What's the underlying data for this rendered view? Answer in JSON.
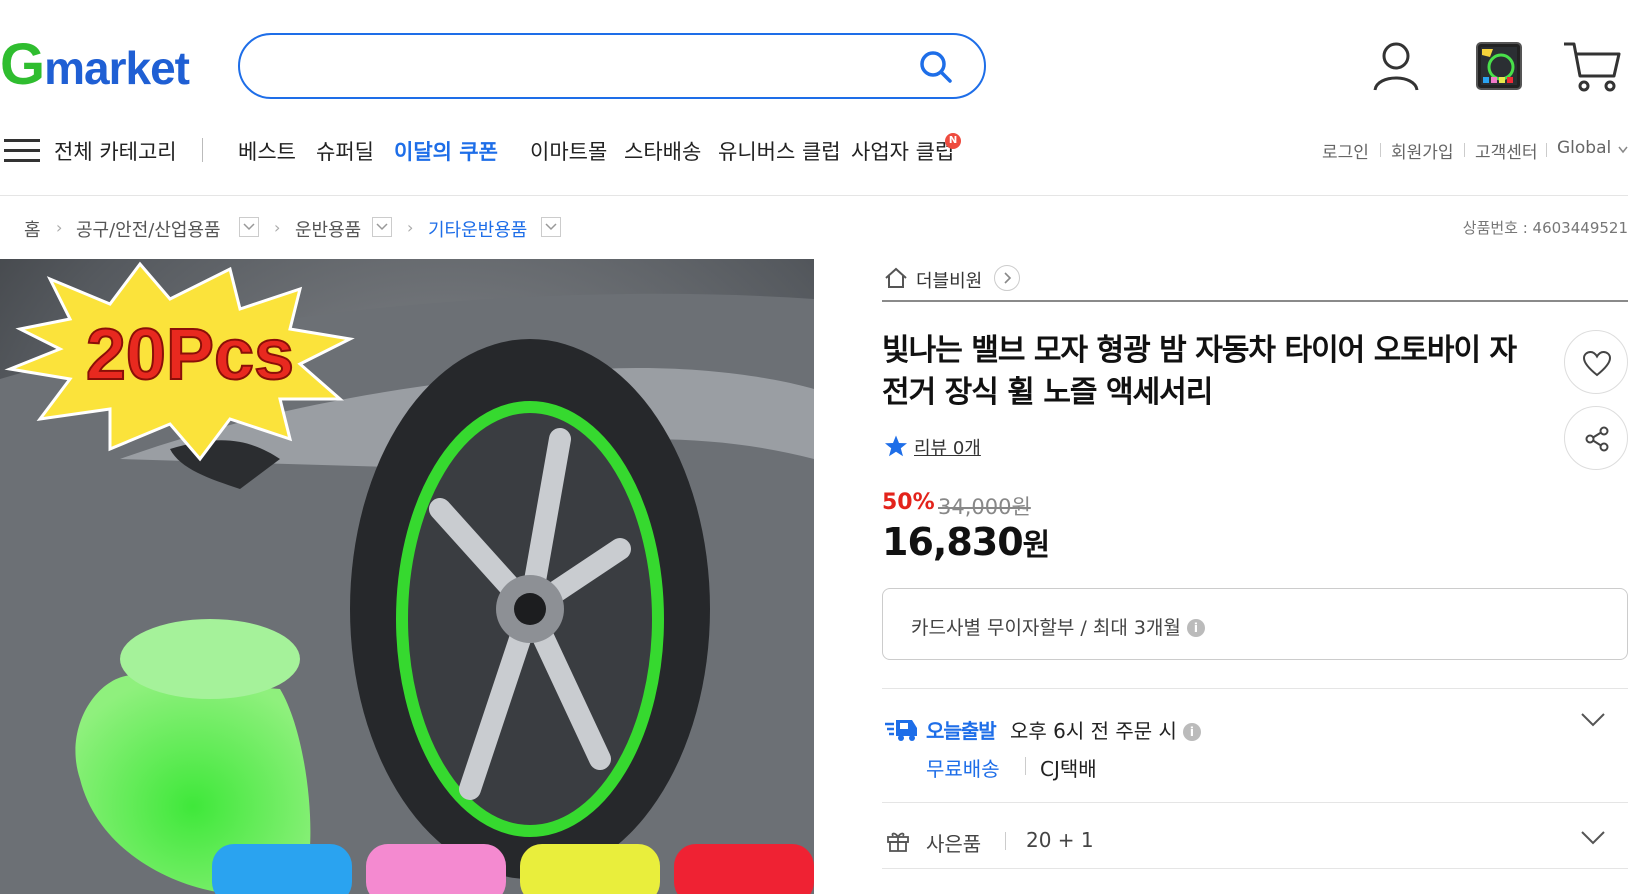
{
  "header": {
    "logo_g": "G",
    "logo_rest": "market",
    "search_placeholder": "",
    "icons": [
      "search-icon",
      "user-icon",
      "recent-item-thumbnail",
      "cart-icon"
    ]
  },
  "nav": {
    "category_label": "전체 카테고리",
    "items": [
      "베스트",
      "슈퍼딜",
      "이달의 쿠폰",
      "이마트몰",
      "스타배송",
      "유니버스 클럽",
      "사업자 클럽"
    ],
    "new_badge": "N",
    "utility": [
      "로그인",
      "회원가입",
      "고객센터",
      "Global"
    ]
  },
  "breadcrumb": {
    "items": [
      "홈",
      "공구/안전/산업용품",
      "운반용품",
      "기타운반용품"
    ],
    "product_number": "상품번호 : 4603449521"
  },
  "product_image": {
    "badge_text": "20Pcs"
  },
  "product": {
    "seller": "더블비원",
    "title": "빛나는 밸브 모자 형광 밤 자동차 타이어 오토바이 자전거 장식 휠 노즐 액세서리",
    "review_label": "리뷰 0개",
    "discount": "50%",
    "original_price": "34,000원",
    "price_number": "16,830",
    "price_unit": "원",
    "installment": "카드사별 무이자할부 / 최대 3개월",
    "info_glyph": "i",
    "shipping_badge": "오늘출발",
    "shipping_time": "오후 6시 전 주문 시",
    "free_shipping": "무료배송",
    "courier": "CJ택배",
    "gift_label": "사은품",
    "gift_value": "20 + 1"
  },
  "colors": {
    "brand_blue": "#1e6ee8",
    "brand_green": "#2fbd2f",
    "discount_red": "#e3231b"
  }
}
